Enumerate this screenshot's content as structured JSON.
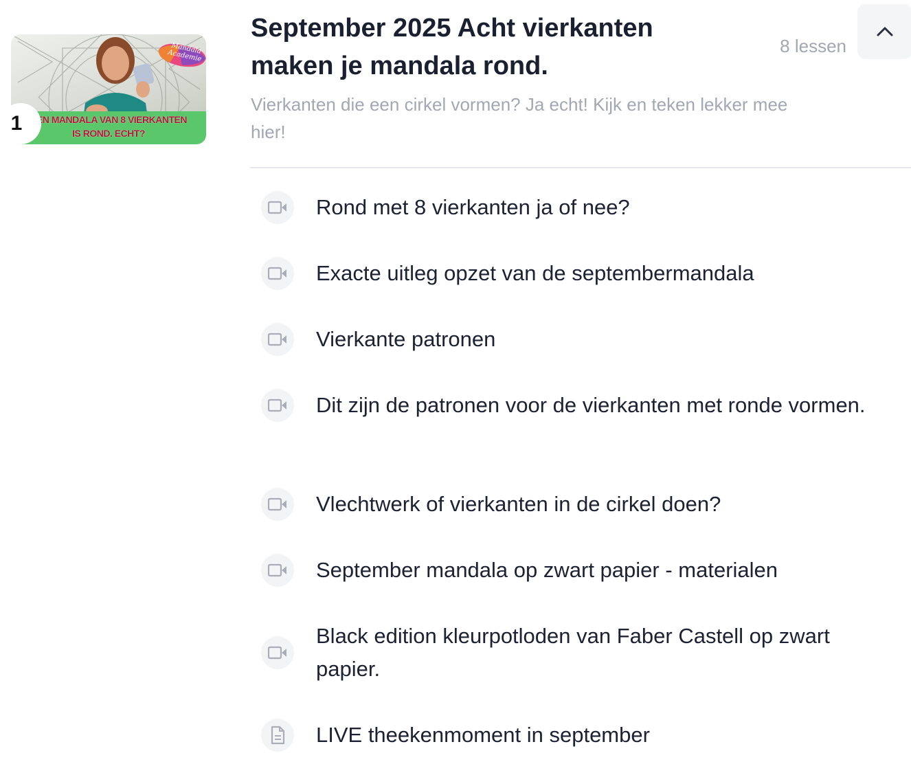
{
  "module": {
    "number": "1",
    "title": "September 2025 Acht vierkanten maken je mandala rond.",
    "lesson_count": "8 lessen",
    "subtitle": "Vierkanten die een cirkel vormen? Ja echt! Kijk en teken lekker mee hier!",
    "collapse_icon": "chevron-up-icon",
    "thumbnail": {
      "banner_line_1": "EEN MANDALA VAN 8 VIERKANTEN",
      "banner_line_2": "IS ROND. ECHT?",
      "badge_line_1": "Mandala",
      "badge_line_2": "Academie"
    }
  },
  "lessons": [
    {
      "title": "Rond met 8 vierkanten ja of nee?",
      "icon": "video-icon"
    },
    {
      "title": "Exacte uitleg opzet van de septembermandala",
      "icon": "video-icon"
    },
    {
      "title": "Vierkante patronen",
      "icon": "video-icon"
    },
    {
      "title": "Dit zijn de patronen voor de vierkanten met ronde vormen.",
      "icon": "video-icon"
    },
    {
      "title": "Vlechtwerk of vierkanten in de cirkel doen?",
      "icon": "video-icon"
    },
    {
      "title": "September mandala op zwart papier - materialen",
      "icon": "video-icon"
    },
    {
      "title": "Black edition kleurpotloden van Faber Castell op zwart papier.",
      "icon": "video-icon"
    },
    {
      "title": "LIVE theekenmoment in september",
      "icon": "document-icon"
    }
  ],
  "colors": {
    "title": "#1b2030",
    "muted": "#a3a7b4",
    "icon": "#a9adb8",
    "icon_bg": "#f3f4f6"
  }
}
